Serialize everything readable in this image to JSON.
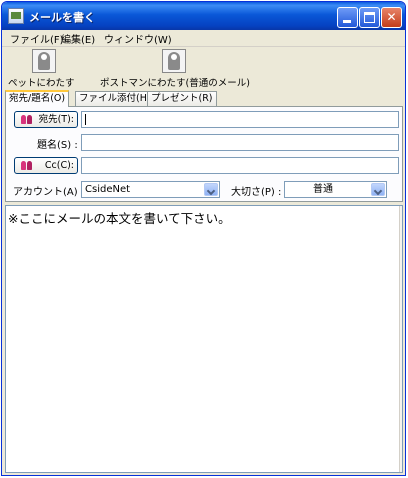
{
  "window": {
    "title": "メールを書く",
    "title_bar_color": "#0a58d8",
    "icon": "mail-window-icon"
  },
  "menu": {
    "items": [
      {
        "label": "ファイル(F)"
      },
      {
        "label": "編集(E)"
      },
      {
        "label": "ウィンドウ(W)"
      }
    ]
  },
  "toolbar": {
    "pet_send_label": "ペットにわたす",
    "pet_send_icon": "pet-icon",
    "postman_send_label": "ポストマンにわたす(普通のメール)",
    "postman_send_icon": "postman-icon"
  },
  "tabs": [
    {
      "label": "宛先/題名(O)",
      "active": true
    },
    {
      "label": "ファイル添付(H)",
      "active": false
    },
    {
      "label": "プレゼント(R)",
      "active": false
    }
  ],
  "form": {
    "to_button": "宛先(T):",
    "to_value": "",
    "subject_label": "題名(S) :",
    "subject_value": "",
    "cc_button": "Cc(C):",
    "cc_value": "",
    "account_label": "アカウント(A) :",
    "account_value": "CsideNet",
    "priority_label": "大切さ(P) :",
    "priority_value": "普通",
    "address_icon": "address-book-icon"
  },
  "body": {
    "text": "※ここにメールの本文を書いて下さい。"
  }
}
